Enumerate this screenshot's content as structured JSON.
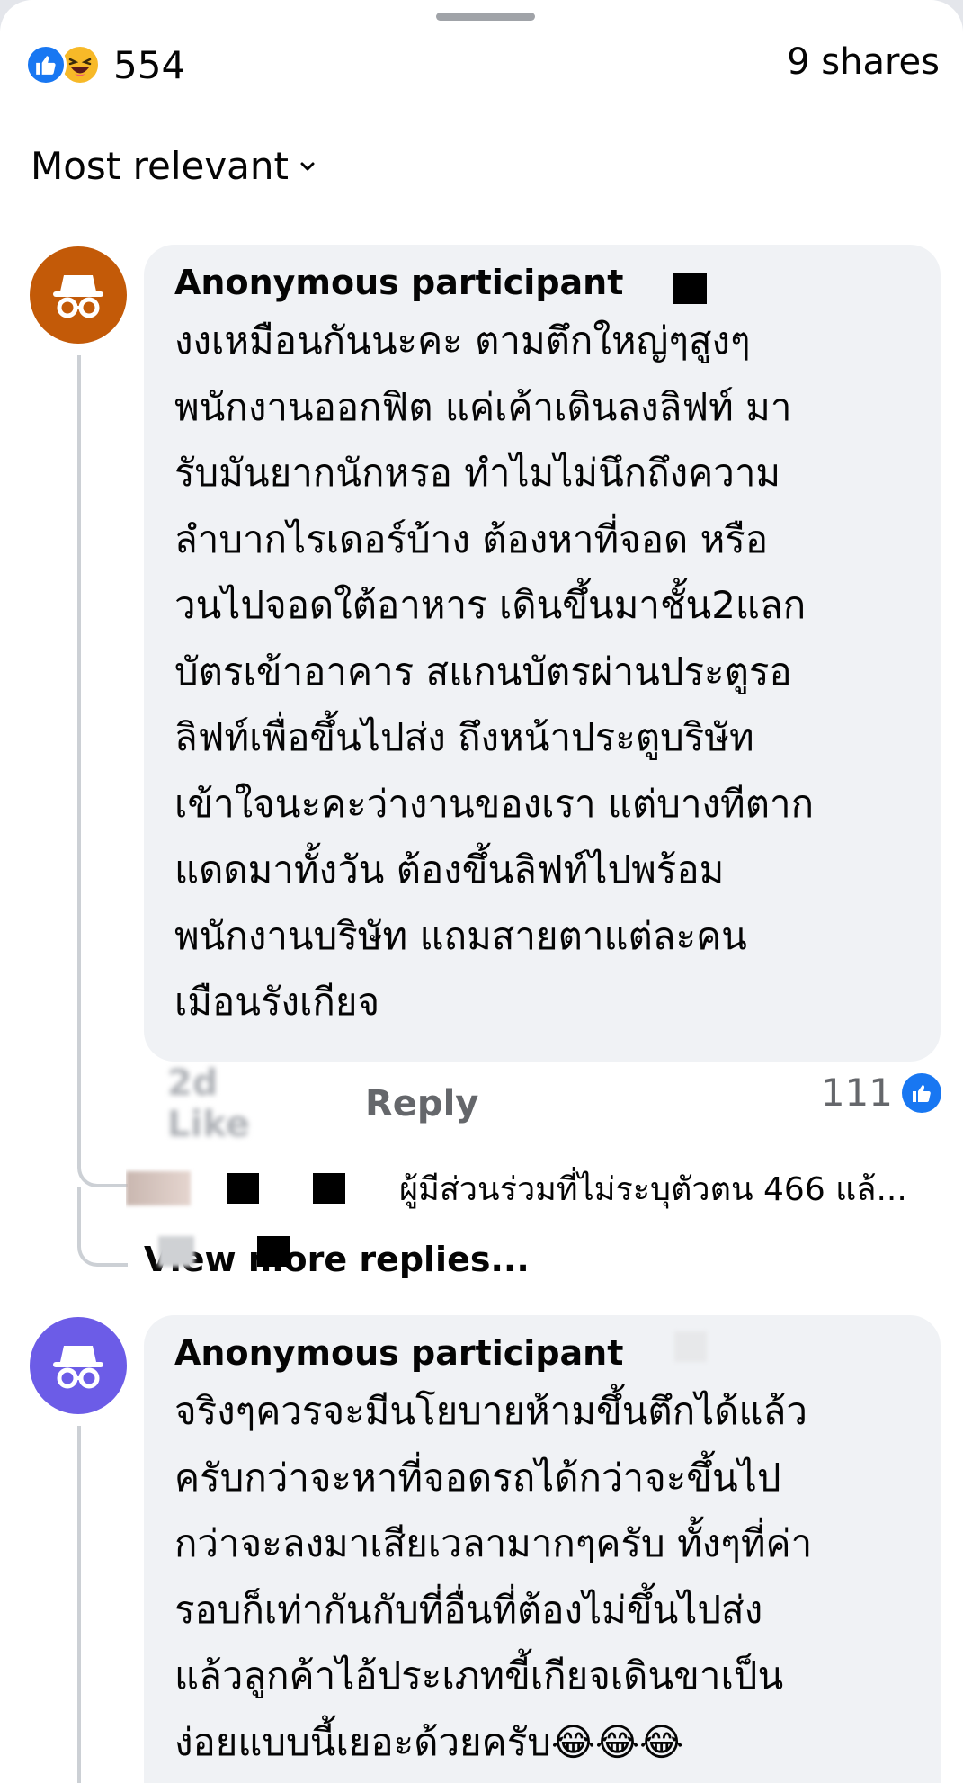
{
  "header": {
    "reaction_icons": [
      "like-icon",
      "haha-icon"
    ],
    "reaction_count": "554",
    "shares": "9 shares"
  },
  "sort": {
    "label": "Most relevant"
  },
  "comments": [
    {
      "avatar_color": "#c35a08",
      "author": "Anonymous participant",
      "lines": [
        "งงเหมือนกันนะคะ ตามตึกใหญ่ๆสูงๆ",
        "พนักงานออกฟิต แค่เค้าเดินลงลิฟท์ มา",
        "รับมันยากนักหรอ ทำไมไม่นึกถึงความ",
        "ลำบากไรเดอร์บ้าง ต้องหาที่จอด หรือ",
        "วนไปจอดใต้อาหาร เดินขึ้นมาชั้น2แลก",
        "บัตรเข้าอาคาร สแกนบัตรผ่านประตูรอ",
        "ลิฟท์เพื่อขึ้นไปส่ง ถึงหน้าประตูบริษัท",
        "เข้าใจนะคะว่างานของเรา แต่บางทีตาก",
        "แดดมาทั้งวัน ต้องขึ้นลิฟท์ไปพร้อม",
        "พนักงานบริษัท แถมสายตาแต่ละคน",
        "เมือนรังเกียจ"
      ],
      "time_blurred": "2d  Like",
      "reply_label": "Reply",
      "like_count": "111",
      "reply_preview": "ผู้มีส่วนร่วมที่ไม่ระบุตัวตน 466 แล้...",
      "view_more": "View    more replies..."
    },
    {
      "avatar_color": "#6c5ce7",
      "author": "Anonymous participant",
      "lines": [
        "จริงๆควรจะมีนโยบายห้ามขึ้นตึกได้แล้ว",
        "ครับกว่าจะหาที่จอดรถได้กว่าจะขึ้นไป",
        "กว่าจะลงมาเสียเวลามากๆครับ ทั้งๆที่ค่า",
        "รอบก็เท่ากันกับที่อื่นที่ต้องไม่ขึ้นไปส่ง",
        "แล้วลูกค้าไอ้ประเภทขี้เกียจเดินขาเป็น",
        "ง่อยแบบนี้เยอะด้วยครับ😂😂😂"
      ]
    }
  ]
}
